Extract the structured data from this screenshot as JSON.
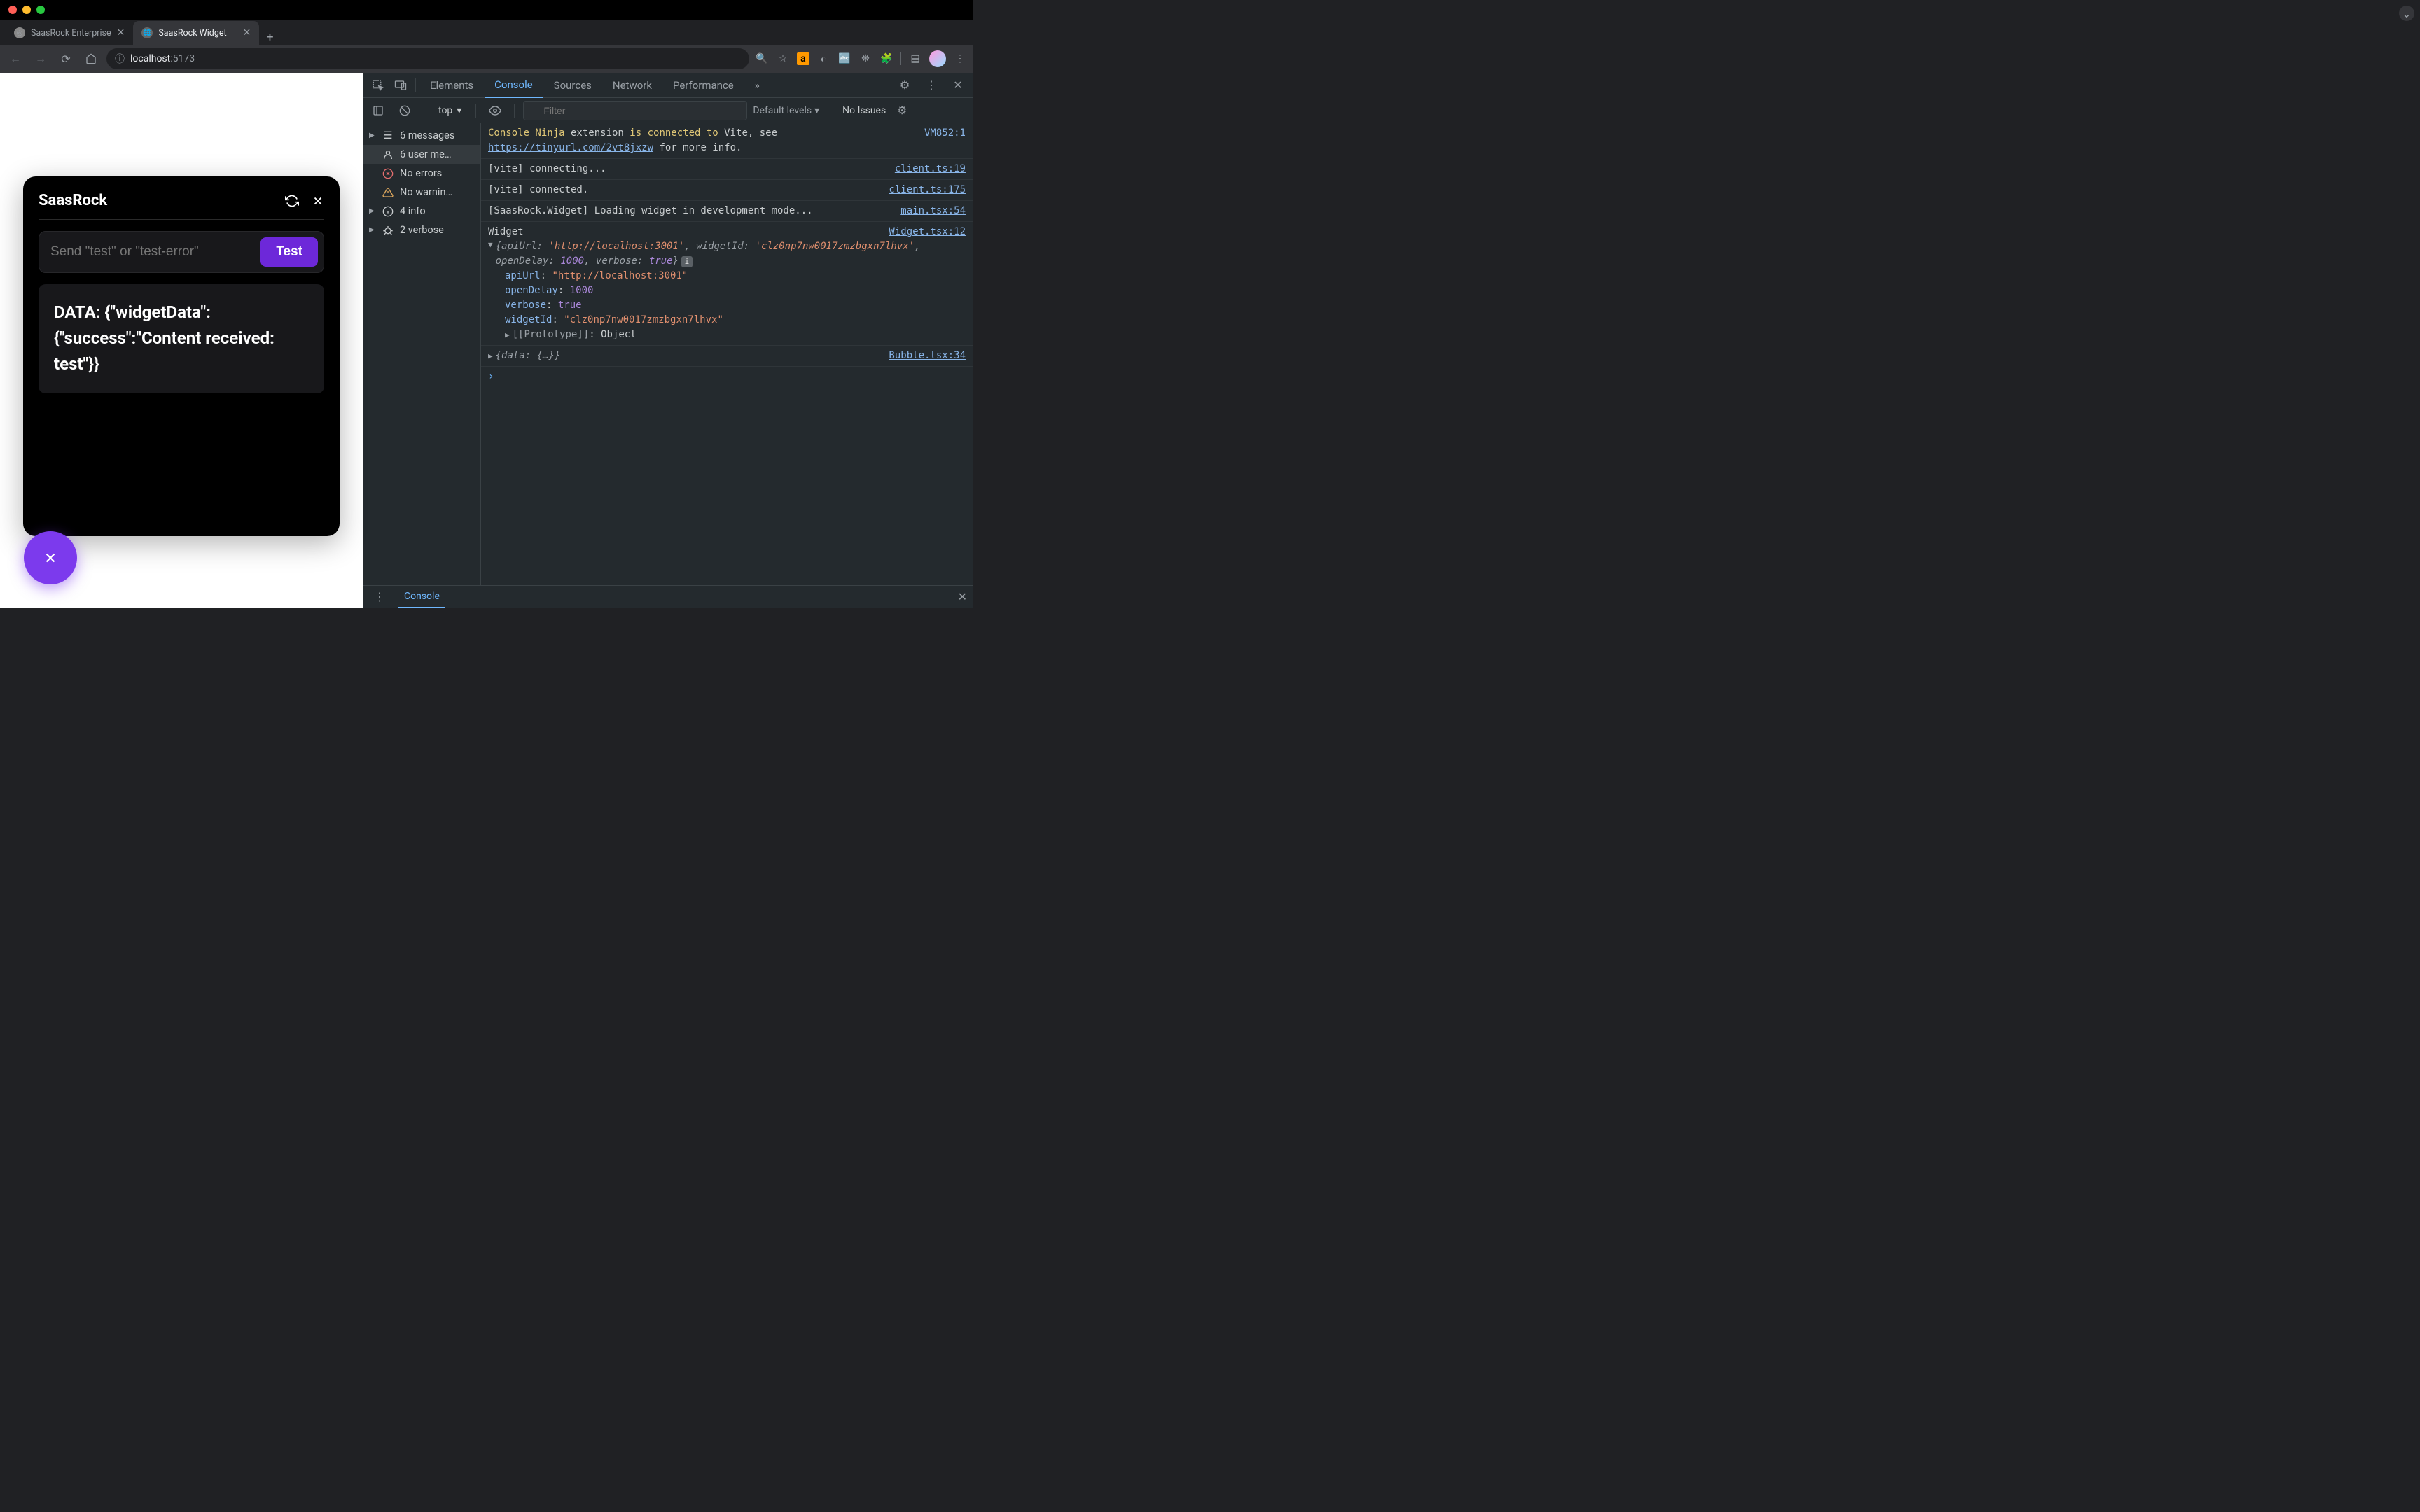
{
  "tabs": [
    {
      "title": "SaasRock Enterprise",
      "active": false
    },
    {
      "title": "SaasRock Widget",
      "active": true
    }
  ],
  "url": {
    "host": "localhost",
    "port": ":5173",
    "info_label": "ⓘ"
  },
  "widget": {
    "title": "SaasRock",
    "input_placeholder": "Send \"test\" or \"test-error\"",
    "test_button": "Test",
    "data_text": "DATA: {\"widgetData\":{\"success\":\"Content received: test\"}}"
  },
  "devtools": {
    "tabs": [
      "Elements",
      "Console",
      "Sources",
      "Network",
      "Performance"
    ],
    "active_tab": "Console",
    "more_tabs": "»",
    "context": "top",
    "filter_placeholder": "Filter",
    "levels": "Default levels",
    "issues": "No Issues",
    "sidebar": [
      {
        "icon": "list",
        "label": "6 messages",
        "chevron": true
      },
      {
        "icon": "user",
        "label": "6 user me…",
        "chevron": false,
        "selected": true
      },
      {
        "icon": "error",
        "label": "No errors",
        "chevron": false
      },
      {
        "icon": "warn",
        "label": "No warnin…",
        "chevron": false
      },
      {
        "icon": "info",
        "label": "4 info",
        "chevron": true
      },
      {
        "icon": "bug",
        "label": "2 verbose",
        "chevron": true
      }
    ],
    "logs": [
      {
        "type": "ninja",
        "pre": "Console Ninja",
        "mid1": " extension ",
        "mid2": "is connected to",
        "mid3": " Vite",
        "post": ", see ",
        "link": "https://tinyurl.com/2vt8jxzw",
        "post2": " for more info.",
        "src": "VM852:1"
      },
      {
        "type": "plain",
        "text": "[vite] connecting...",
        "src": "client.ts:19"
      },
      {
        "type": "plain",
        "text": "[vite] connected.",
        "src": "client.ts:175"
      },
      {
        "type": "plain",
        "text": "[SaasRock.Widget] Loading widget in development mode...",
        "src": "main.tsx:54"
      },
      {
        "type": "object",
        "header": "Widget",
        "src": "Widget.tsx:12",
        "preview_apiUrl": "'http://localhost:3001'",
        "preview_widgetId": "'clz0np7nw0017zmzbgxn7lhvx'",
        "preview_openDelay": "1000",
        "preview_verbose": "true",
        "props": {
          "apiUrl": "\"http://localhost:3001\"",
          "openDelay": "1000",
          "verbose": "true",
          "widgetId": "\"clz0np7nw0017zmzbgxn7lhvx\""
        },
        "proto": "Object"
      },
      {
        "type": "collapsed",
        "preview": "{data: {…}}",
        "src": "Bubble.tsx:34"
      }
    ],
    "drawer_tab": "Console"
  }
}
